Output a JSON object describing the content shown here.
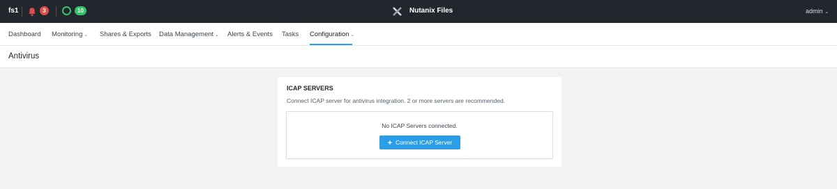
{
  "topbar": {
    "file_server_name": "fs1",
    "alerts_count": "3",
    "tasks_count": "10",
    "app_title": "Nutanix Files",
    "user": "admin",
    "icons": {
      "alerts": "bell-icon",
      "tasks": "circle-icon",
      "logo": "nutanix-x-logo",
      "user_menu": "chevron-down-icon"
    },
    "colors": {
      "bar_bg": "#22272e",
      "alert_badge": "#e04d4d",
      "task_badge": "#36c26b"
    }
  },
  "nav": {
    "items": [
      {
        "label": "Dashboard",
        "has_menu": false
      },
      {
        "label": "Monitoring",
        "has_menu": true
      },
      {
        "label": "Shares & Exports",
        "has_menu": false
      },
      {
        "label": "Data Management",
        "has_menu": true
      },
      {
        "label": "Alerts & Events",
        "has_menu": false
      },
      {
        "label": "Tasks",
        "has_menu": false
      },
      {
        "label": "Configuration",
        "has_menu": true,
        "active": true
      }
    ],
    "accent": "#2a9ee8"
  },
  "page": {
    "title": "Antivirus"
  },
  "icap": {
    "title": "ICAP SERVERS",
    "description": "Connect ICAP server for antivirus integration. 2 or more servers are recommended.",
    "empty_message": "No ICAP Servers connected.",
    "connect_button": "Connect ICAP Server",
    "button_icon": "plus-icon"
  }
}
